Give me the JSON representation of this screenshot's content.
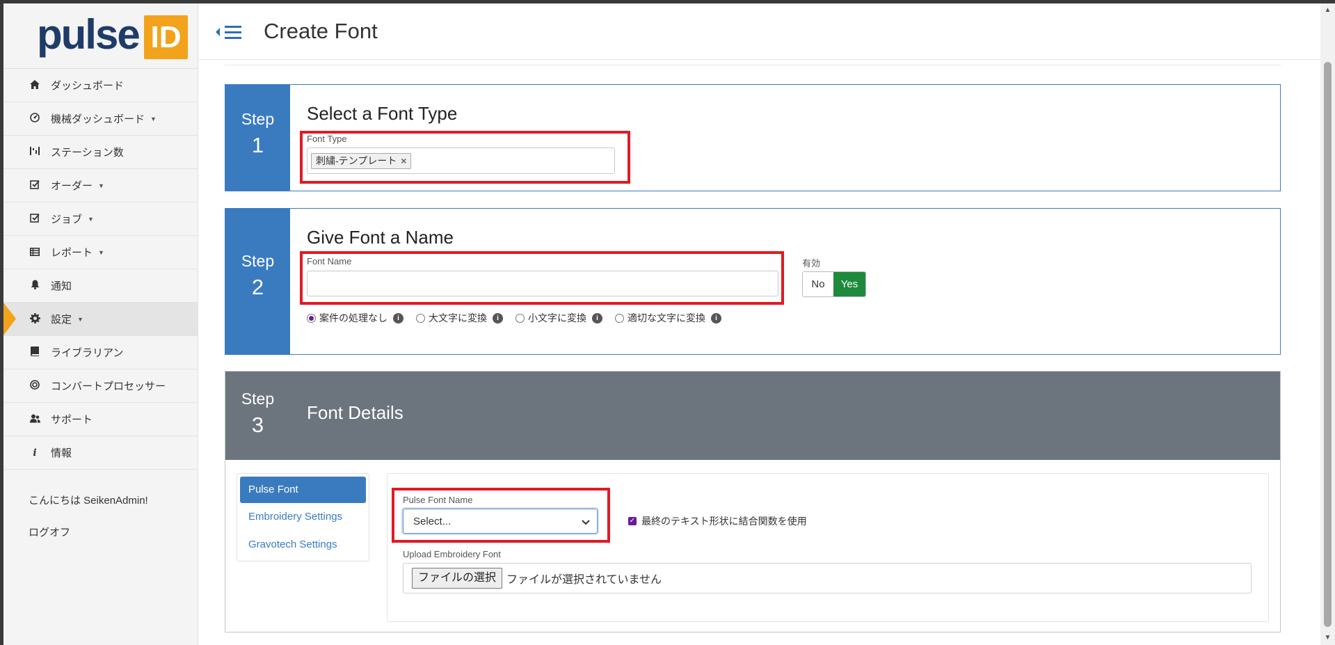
{
  "brand": {
    "logo_text": "pulse",
    "logo_badge": "ID"
  },
  "header": {
    "title": "Create Font"
  },
  "sidebar": {
    "items": [
      {
        "label": "ダッシュボード",
        "icon": "home-icon"
      },
      {
        "label": "機械ダッシュボード",
        "icon": "dashboard-icon"
      },
      {
        "label": "ステーション数",
        "icon": "stations-icon"
      },
      {
        "label": "オーダー",
        "icon": "checkbox-icon"
      },
      {
        "label": "ジョブ",
        "icon": "checkbox-icon"
      },
      {
        "label": "レポート",
        "icon": "table-icon"
      },
      {
        "label": "通知",
        "icon": "bell-icon"
      },
      {
        "label": "設定",
        "icon": "gear-icon"
      },
      {
        "label": "ライブラリアン",
        "icon": "book-icon"
      },
      {
        "label": "コンバートプロセッサー",
        "icon": "target-icon"
      },
      {
        "label": "サポート",
        "icon": "users-icon"
      },
      {
        "label": "情報",
        "icon": "info-icon"
      }
    ],
    "greeting": "こんにちは SeikenAdmin!",
    "logout": "ログオフ"
  },
  "step1": {
    "step_word": "Step",
    "step_num": "1",
    "title": "Select a Font Type",
    "field_label": "Font Type",
    "selected_tag": "刺繍-テンプレート"
  },
  "step2": {
    "step_word": "Step",
    "step_num": "2",
    "title": "Give Font a Name",
    "field_label": "Font Name",
    "field_value": "",
    "enabled_label": "有効",
    "toggle_no": "No",
    "toggle_yes": "Yes",
    "toggle_value": "Yes",
    "case_options": [
      {
        "label": "案件の処理なし",
        "selected": true
      },
      {
        "label": "大文字に変換",
        "selected": false
      },
      {
        "label": "小文字に変換",
        "selected": false
      },
      {
        "label": "適切な文字に変換",
        "selected": false
      }
    ]
  },
  "step3": {
    "step_word": "Step",
    "step_num": "3",
    "title": "Font Details",
    "tabs": [
      "Pulse Font",
      "Embroidery Settings",
      "Gravotech Settings"
    ],
    "active_tab": "Pulse Font",
    "pulse_font_label": "Pulse Font Name",
    "pulse_font_selected": "Select...",
    "combine_label": "最終のテキスト形状に結合関数を使用",
    "combine_checked": true,
    "upload_label": "Upload Embroidery Font",
    "file_button": "ファイルの選択",
    "file_status": "ファイルが選択されていません"
  },
  "colors": {
    "accent": "#3a7bc0",
    "brand_orange": "#f2a31b",
    "highlight_red": "#e01b24",
    "toggle_yes_green": "#1e8a3c",
    "step3_header": "#6c757d"
  }
}
